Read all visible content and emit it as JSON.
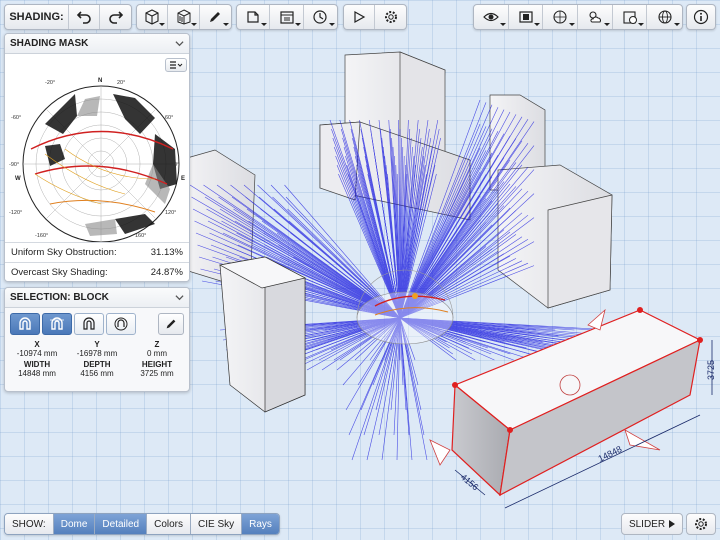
{
  "toolbar": {
    "shading_label": "SHADING:"
  },
  "shading_panel": {
    "title": "SHADING MASK",
    "compass": {
      "n": "N",
      "s": "S",
      "e": "E",
      "w": "W"
    },
    "rows": [
      {
        "label": "Uniform Sky Obstruction:",
        "value": "31.13%"
      },
      {
        "label": "Overcast Sky Shading:",
        "value": "24.87%"
      }
    ]
  },
  "selection_panel": {
    "title": "SELECTION: BLOCK",
    "fields": [
      {
        "key": "X",
        "value": "-10974 mm"
      },
      {
        "key": "Y",
        "value": "-16978 mm"
      },
      {
        "key": "Z",
        "value": "0 mm"
      },
      {
        "key": "WIDTH",
        "value": "14848 mm"
      },
      {
        "key": "DEPTH",
        "value": "4156 mm"
      },
      {
        "key": "HEIGHT",
        "value": "3725 mm"
      }
    ]
  },
  "scene": {
    "dim_length": "14848",
    "dim_depth": "4156",
    "dim_height": "3725"
  },
  "bottom": {
    "show_label": "SHOW:",
    "toggles": [
      {
        "label": "Dome",
        "on": true
      },
      {
        "label": "Detailed",
        "on": true
      },
      {
        "label": "Colors",
        "on": false
      },
      {
        "label": "CIE Sky",
        "on": false
      },
      {
        "label": "Rays",
        "on": true
      }
    ],
    "slider_label": "SLIDER"
  }
}
